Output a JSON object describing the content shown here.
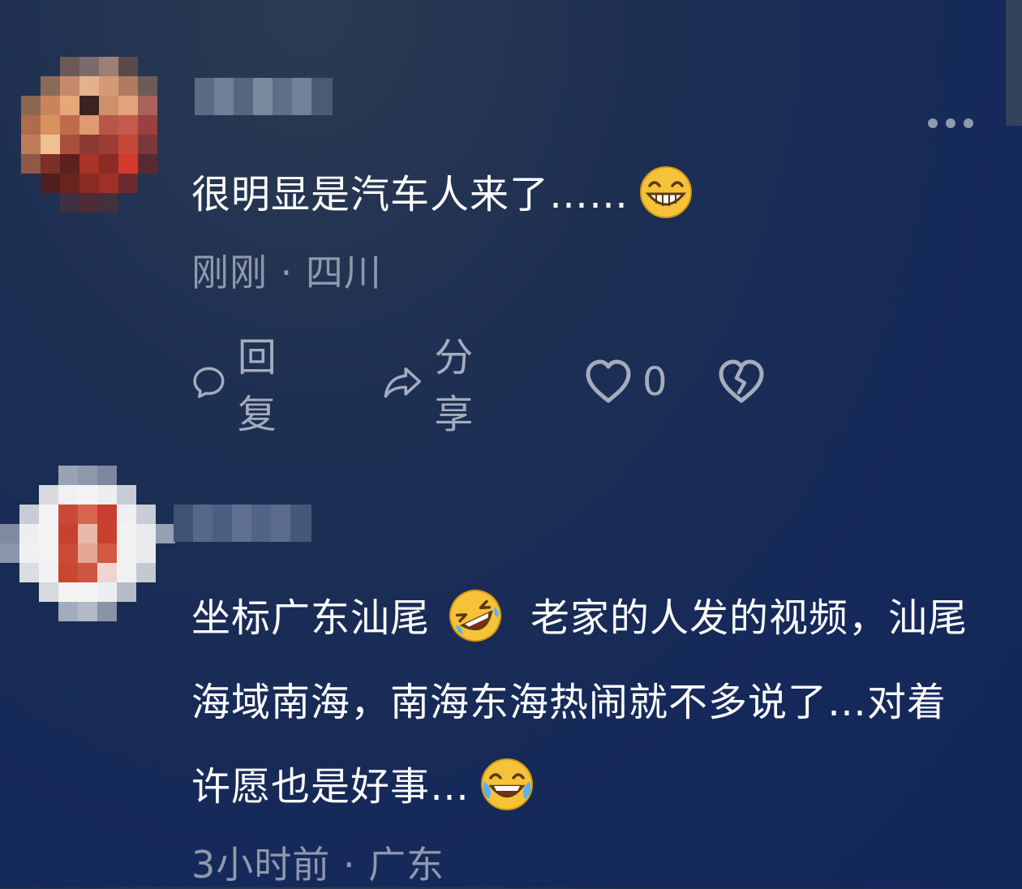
{
  "comments": [
    {
      "text_before_emoji": "很明显是汽车人来了……",
      "emoji_icon": "grinning-face-icon",
      "meta": {
        "time": "刚刚",
        "separator": "·",
        "location": "四川"
      },
      "actions": {
        "reply_label": "回复",
        "share_label": "分享",
        "like_count": "0"
      }
    },
    {
      "text_part1": "坐标广东汕尾",
      "emoji1_icon": "rolling-on-floor-laughing-icon",
      "text_part2": "老家的人发的视频，汕尾海域南海，南海东海热闹就不多说了…对着许愿也是好事…",
      "emoji2_icon": "face-with-tears-of-joy-icon",
      "meta": {
        "time": "3小时前",
        "separator": "·",
        "location": "广东"
      }
    }
  ],
  "colors": {
    "background": "#1b2e56",
    "text": "#ffffff",
    "meta_text": "#8f99ab",
    "action_text": "#a5adbd"
  }
}
